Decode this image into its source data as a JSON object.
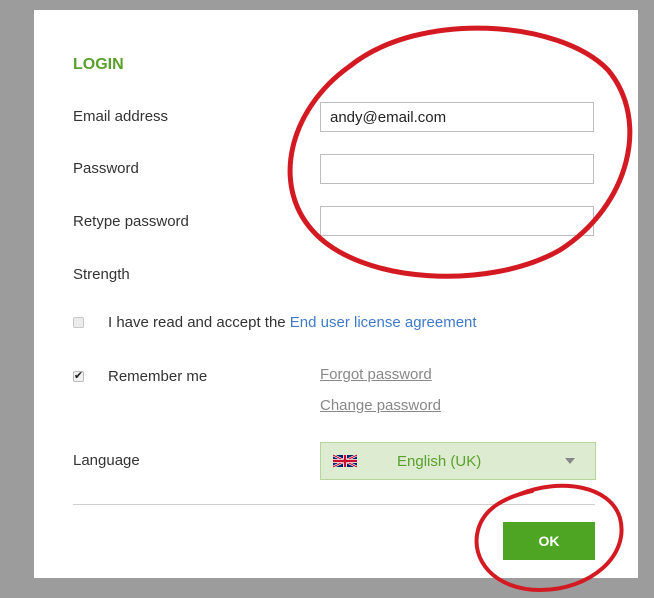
{
  "login": {
    "title": "LOGIN",
    "email": {
      "label": "Email address",
      "value": "andy@email.com"
    },
    "password": {
      "label": "Password",
      "value": ""
    },
    "retype": {
      "label": "Retype password",
      "value": ""
    },
    "strength": {
      "label": "Strength"
    },
    "eula": {
      "checked": false,
      "prefix": "I have read and accept the ",
      "link": "End user license agreement"
    },
    "remember": {
      "checked": true,
      "label": "Remember me"
    },
    "forgot_link": "Forgot password",
    "change_link": "Change password",
    "language": {
      "label": "Language",
      "selected": "English (UK)",
      "flag": "uk-flag-icon"
    },
    "ok_label": "OK"
  },
  "colors": {
    "accent_green": "#5aa02c",
    "button_green": "#4ea523",
    "link_blue": "#3f7ac9",
    "annotation_red": "#d31a22"
  }
}
